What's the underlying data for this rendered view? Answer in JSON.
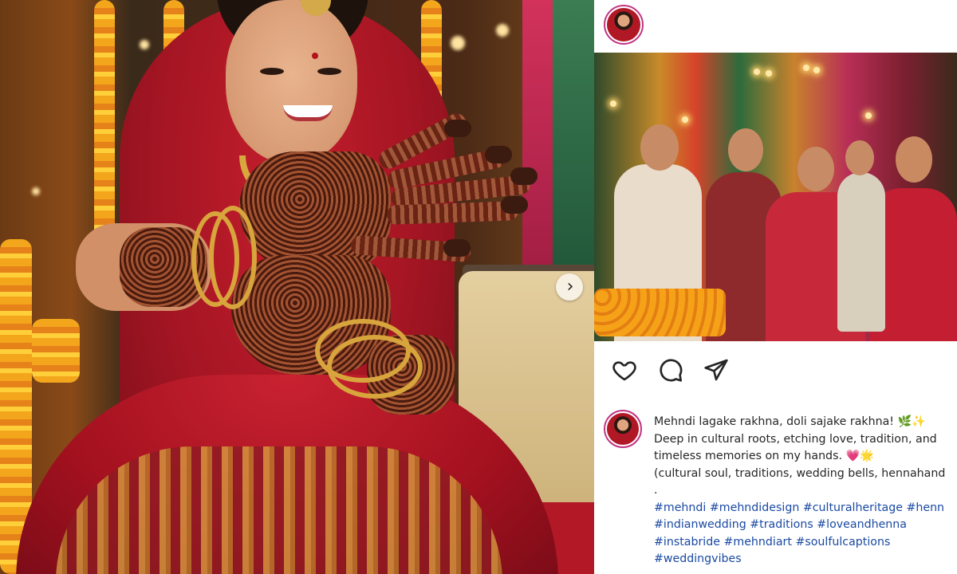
{
  "post": {
    "carousel_next_icon": "chevron-right-icon",
    "carousel_next_glyph": "›"
  },
  "panel": {
    "actions": {
      "like_icon": "heart-icon",
      "comment_icon": "comment-bubble-icon",
      "share_icon": "paper-plane-icon"
    },
    "caption": {
      "line1": "Mehndi lagake rakhna, doli sajake rakhna!",
      "line1_emoji_1": "🌿",
      "line1_emoji_2": "✨",
      "line2": "Deep in cultural roots, etching love, tradition, and",
      "line3": "timeless memories on my hands.",
      "line3_emoji_1": "💗",
      "line3_emoji_2": "🌟",
      "line4": "(cultural soul, traditions, wedding bells, hennahand",
      "line5": ".",
      "hashtags_line1": "#mehndi #mehndidesign #culturalheritage #henn",
      "hashtags_line2": "#indianwedding #traditions #loveandhenna",
      "hashtags_line3": "#instabride #mehndiart #soulfulcaptions",
      "hashtags_line4": "#weddingvibes"
    },
    "colors": {
      "hashtag": "#1a4aa3",
      "avatar_ring": "#c13584",
      "text": "#262626"
    }
  }
}
